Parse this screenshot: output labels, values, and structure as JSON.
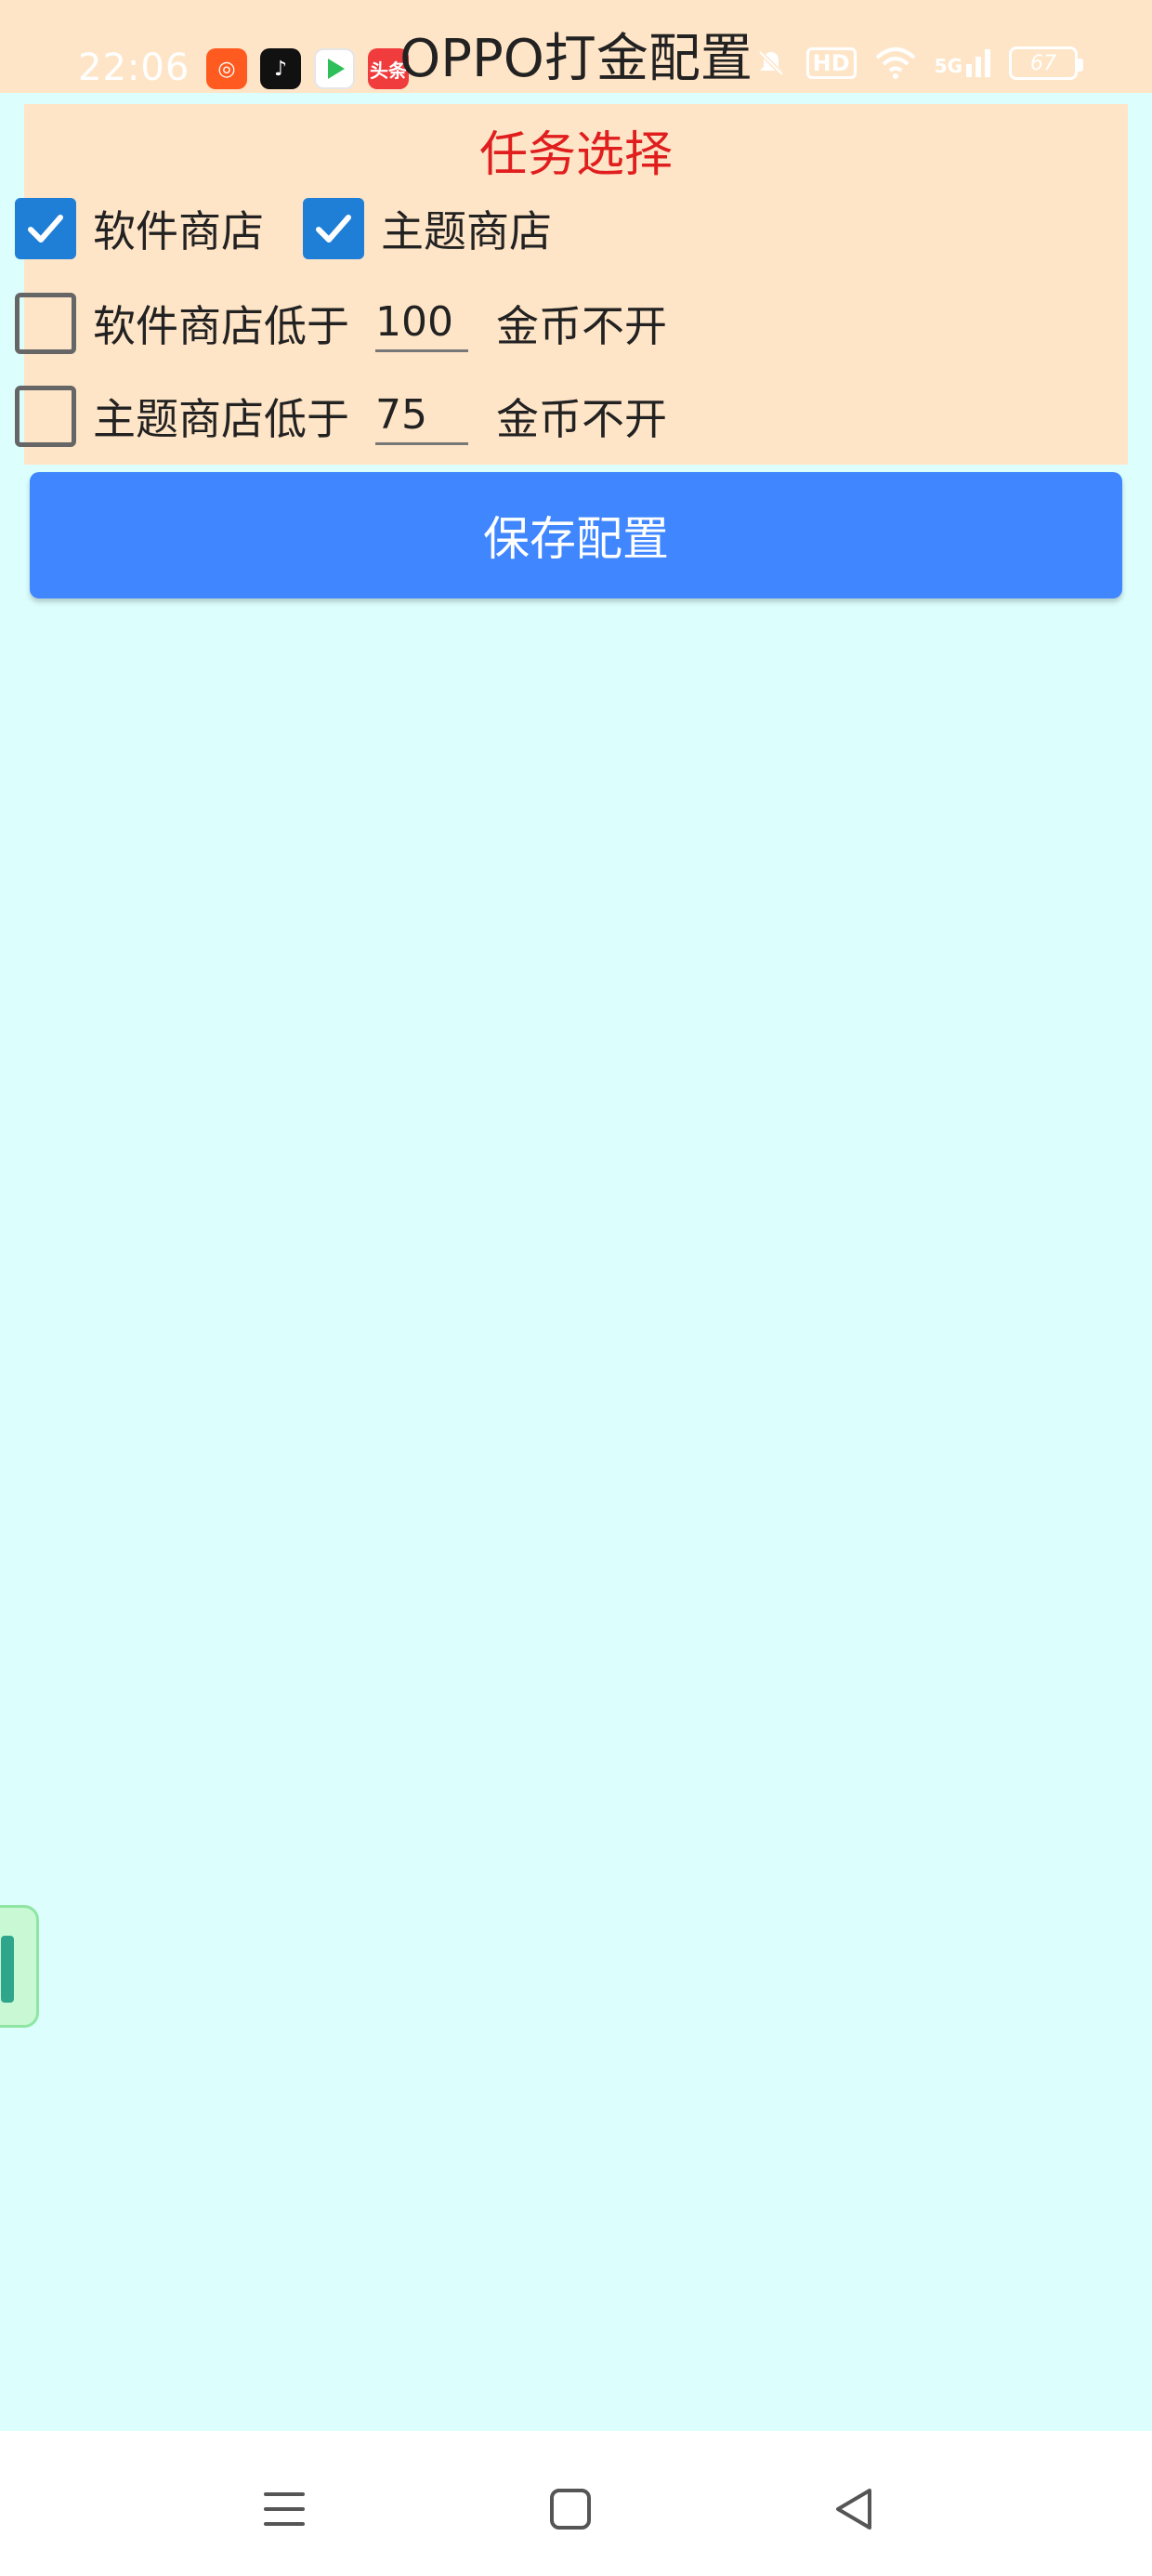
{
  "status_bar": {
    "time": "22:06",
    "notification_icons": [
      {
        "name": "kuaishou-app-icon",
        "glyph": "◎"
      },
      {
        "name": "douyin-app-icon",
        "glyph": "♪"
      },
      {
        "name": "video-app-icon",
        "glyph": "▶"
      },
      {
        "name": "toutiao-app-icon",
        "glyph": "头条"
      }
    ],
    "right_icons": [
      "mute-icon",
      "hd-icon",
      "wifi-icon",
      "5g-signal-icon"
    ],
    "hd_text": "HD",
    "network_text": "5G",
    "battery_level": "67"
  },
  "header": {
    "title": "OPPO打金配置"
  },
  "panel": {
    "title": "任务选择",
    "row1": {
      "software_store_label": "软件商店",
      "software_store_checked": true,
      "theme_store_label": "主题商店",
      "theme_store_checked": true
    },
    "row2": {
      "label": "软件商店低于",
      "checked": false,
      "value": "100",
      "suffix": "金币不开"
    },
    "row3": {
      "label": "主题商店低于",
      "checked": false,
      "value": "75",
      "suffix": "金币不开"
    }
  },
  "save_button": {
    "label": "保存配置"
  },
  "nav_bar": {
    "items": [
      "menu-icon",
      "home-icon",
      "back-icon"
    ]
  },
  "colors": {
    "page_background": "#dcfffd",
    "panel_background": "#ffe5c7",
    "accent_blue": "#3f86ff",
    "checkbox_blue": "#1f7fd6",
    "title_red": "#e01e1e"
  }
}
